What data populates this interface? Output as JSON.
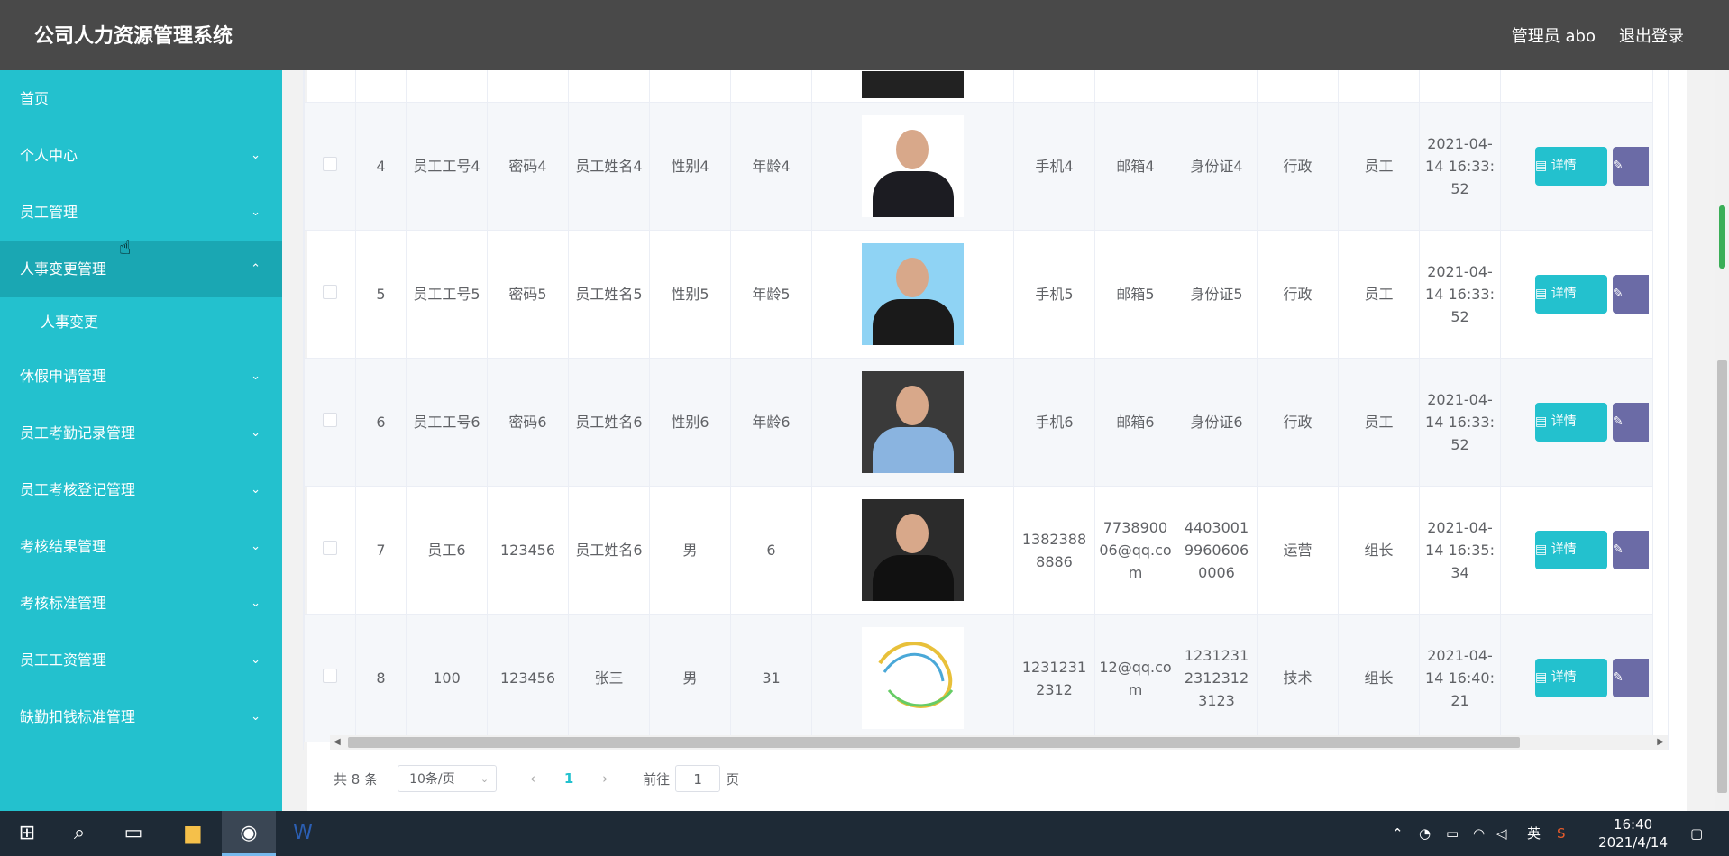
{
  "header": {
    "title": "公司人力资源管理系统",
    "user": "管理员 abo",
    "logout": "退出登录"
  },
  "sidebar": {
    "items": [
      {
        "label": "首页",
        "chev": ""
      },
      {
        "label": "个人中心",
        "chev": "⌄"
      },
      {
        "label": "员工管理",
        "chev": "⌄"
      },
      {
        "label": "人事变更管理",
        "chev": "⌃"
      },
      {
        "label": "休假申请管理",
        "chev": "⌄"
      },
      {
        "label": "员工考勤记录管理",
        "chev": "⌄"
      },
      {
        "label": "员工考核登记管理",
        "chev": "⌄"
      },
      {
        "label": "考核结果管理",
        "chev": "⌄"
      },
      {
        "label": "考核标准管理",
        "chev": "⌄"
      },
      {
        "label": "员工工资管理",
        "chev": "⌄"
      },
      {
        "label": "缺勤扣钱标准管理",
        "chev": "⌄"
      }
    ],
    "sub_item": "人事变更"
  },
  "table": {
    "rows": [
      {
        "idx": "4",
        "no": "员工工号4",
        "pwd": "密码4",
        "name": "员工姓名4",
        "sex": "性别4",
        "age": "年龄4",
        "phone": "手机4",
        "email": "邮箱4",
        "idcard": "身份证4",
        "dept": "行政",
        "role": "员工",
        "time": "2021-04-14 16:33:52"
      },
      {
        "idx": "5",
        "no": "员工工号5",
        "pwd": "密码5",
        "name": "员工姓名5",
        "sex": "性别5",
        "age": "年龄5",
        "phone": "手机5",
        "email": "邮箱5",
        "idcard": "身份证5",
        "dept": "行政",
        "role": "员工",
        "time": "2021-04-14 16:33:52"
      },
      {
        "idx": "6",
        "no": "员工工号6",
        "pwd": "密码6",
        "name": "员工姓名6",
        "sex": "性别6",
        "age": "年龄6",
        "phone": "手机6",
        "email": "邮箱6",
        "idcard": "身份证6",
        "dept": "行政",
        "role": "员工",
        "time": "2021-04-14 16:33:52"
      },
      {
        "idx": "7",
        "no": "员工6",
        "pwd": "123456",
        "name": "员工姓名6",
        "sex": "男",
        "age": "6",
        "phone": "13823888886",
        "email": "773890006@qq.com",
        "idcard": "440300199606060006",
        "dept": "运营",
        "role": "组长",
        "time": "2021-04-14 16:35:34"
      },
      {
        "idx": "8",
        "no": "100",
        "pwd": "123456",
        "name": "张三",
        "sex": "男",
        "age": "31",
        "phone": "12312312312",
        "email": "12@qq.com",
        "idcard": "123123123123123123",
        "dept": "技术",
        "role": "组长",
        "time": "2021-04-14 16:40:21"
      }
    ],
    "detail_label": "详情",
    "edit_icon": "edit-icon"
  },
  "pager": {
    "total": "共 8 条",
    "size": "10条/页",
    "page": "1",
    "goto": "前往",
    "goto_value": "1",
    "unit": "页"
  },
  "taskbar": {
    "time": "16:40",
    "date": "2021/4/14",
    "ime": "英"
  },
  "colors": {
    "sidebar": "#23c1ce",
    "header": "#494949",
    "accent": "#23c1ce",
    "edit": "#6b6ba6"
  }
}
